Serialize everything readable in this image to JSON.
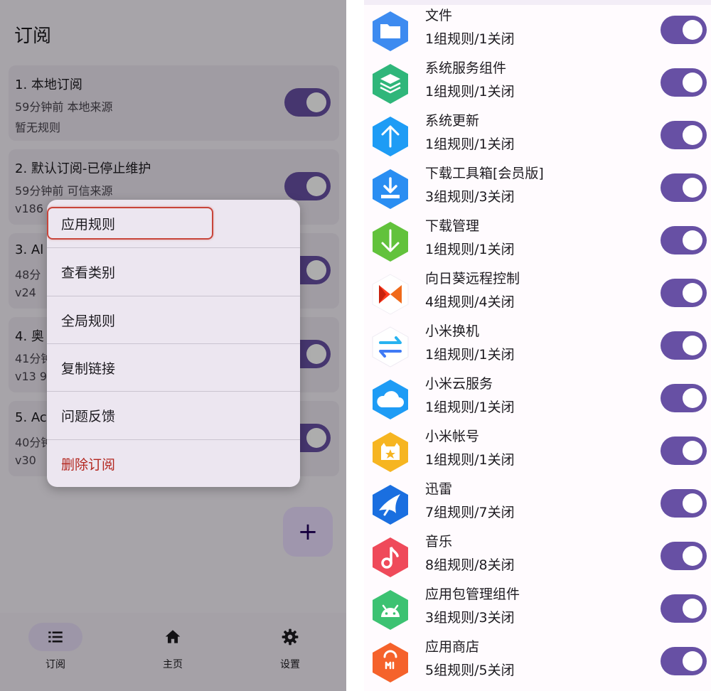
{
  "left_panel": {
    "title": "订阅",
    "subscriptions": [
      {
        "name": "1. 本地订阅",
        "meta": "59分钟前   本地来源",
        "rules": "暂无规则",
        "enabled": true
      },
      {
        "name": "2. 默认订阅-已停止维护",
        "meta": "59分钟前   可信来源",
        "rules": "v186",
        "enabled": true
      },
      {
        "name": "3. Al",
        "meta": "48分",
        "rules": "v24",
        "enabled": true
      },
      {
        "name": "4. 奥",
        "meta": "41分钟",
        "rules": "v13   9",
        "enabled": true
      },
      {
        "name": "5. Ac",
        "meta": "40分钟",
        "rules": "v30",
        "enabled": true
      }
    ],
    "context_menu": {
      "items": [
        {
          "label": "应用规则",
          "highlighted": true
        },
        {
          "label": "查看类别"
        },
        {
          "label": "全局规则"
        },
        {
          "label": "复制链接"
        },
        {
          "label": "问题反馈"
        },
        {
          "label": "删除订阅",
          "danger": true
        }
      ]
    },
    "fab": {
      "symbol": "+",
      "icon": "plus-icon"
    },
    "bottom_nav": [
      {
        "label": "订阅",
        "icon": "list-icon",
        "active": true
      },
      {
        "label": "主页",
        "icon": "home-icon",
        "active": false
      },
      {
        "label": "设置",
        "icon": "gear-icon",
        "active": false
      }
    ]
  },
  "right_panel": {
    "apps": [
      {
        "name": "文件",
        "count": "1组规则/1关闭",
        "icon": "folder-icon",
        "color": "#3d8bf0",
        "enabled": true
      },
      {
        "name": "系统服务组件",
        "count": "1组规则/1关闭",
        "icon": "stack-icon",
        "color": "#2fb67a",
        "enabled": true
      },
      {
        "name": "系统更新",
        "count": "1组规则/1关闭",
        "icon": "arrow-up-icon",
        "color": "#1e9cf5",
        "enabled": true
      },
      {
        "name": "下载工具箱[会员版]",
        "count": "3组规则/3关闭",
        "icon": "download-tray-icon",
        "color": "#2a8ef2",
        "enabled": true
      },
      {
        "name": "下载管理",
        "count": "1组规则/1关闭",
        "icon": "arrow-down-icon",
        "color": "#62c23c",
        "enabled": true
      },
      {
        "name": "向日葵远程控制",
        "count": "4组规则/4关闭",
        "icon": "sunflower-icon",
        "color": "#f05a28",
        "enabled": true
      },
      {
        "name": "小米换机",
        "count": "1组规则/1关闭",
        "icon": "swap-icon",
        "color": "#27b3f0",
        "enabled": true
      },
      {
        "name": "小米云服务",
        "count": "1组规则/1关闭",
        "icon": "cloud-icon",
        "color": "#1e9cf5",
        "enabled": true
      },
      {
        "name": "小米帐号",
        "count": "1组规则/1关闭",
        "icon": "mi-account-icon",
        "color": "#f6b521",
        "enabled": true
      },
      {
        "name": "迅雷",
        "count": "7组规则/7关闭",
        "icon": "thunder-bird-icon",
        "color": "#1a6fe0",
        "enabled": true
      },
      {
        "name": "音乐",
        "count": "8组规则/8关闭",
        "icon": "music-note-icon",
        "color": "#ef4a5a",
        "enabled": true
      },
      {
        "name": "应用包管理组件",
        "count": "3组规则/3关闭",
        "icon": "android-icon",
        "color": "#3cc272",
        "enabled": true
      },
      {
        "name": "应用商店",
        "count": "5组规则/5关闭",
        "icon": "mi-store-icon",
        "color": "#f5622b",
        "enabled": true
      }
    ]
  },
  "colors": {
    "accent": "#6750a4",
    "danger": "#b3261e",
    "highlight_border": "#c8453a"
  }
}
